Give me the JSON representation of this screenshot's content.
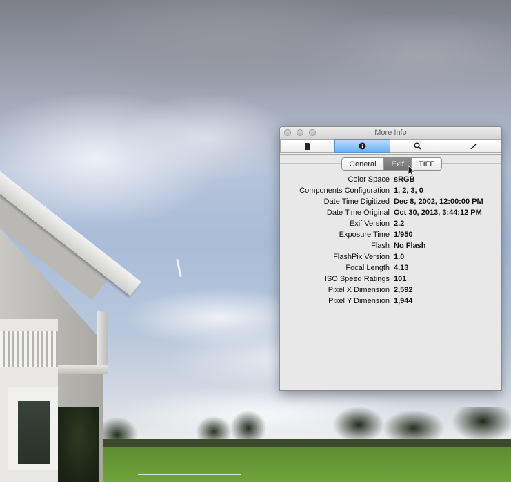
{
  "window": {
    "title": "More Info",
    "toolbar": [
      {
        "name": "general-info",
        "icon": "document-icon"
      },
      {
        "name": "more-info",
        "icon": "info-icon",
        "active": true
      },
      {
        "name": "keywords",
        "icon": "magnifier-icon"
      },
      {
        "name": "annotations",
        "icon": "pen-icon"
      }
    ],
    "tabs": [
      {
        "label": "General",
        "active": false
      },
      {
        "label": "Exif",
        "active": true
      },
      {
        "label": "TIFF",
        "active": false
      }
    ],
    "rows": [
      {
        "key": "Color Space",
        "value": "sRGB"
      },
      {
        "key": "Components Configuration",
        "value": "1, 2, 3, 0"
      },
      {
        "key": "Date Time Digitized",
        "value": "Dec 8, 2002, 12:00:00 PM"
      },
      {
        "key": "Date Time Original",
        "value": "Oct 30, 2013, 3:44:12 PM"
      },
      {
        "key": "Exif Version",
        "value": "2.2"
      },
      {
        "key": "Exposure Time",
        "value": "1/950"
      },
      {
        "key": "Flash",
        "value": "No Flash"
      },
      {
        "key": "FlashPix Version",
        "value": "1.0"
      },
      {
        "key": "Focal Length",
        "value": "4.13"
      },
      {
        "key": "ISO Speed Ratings",
        "value": "101"
      },
      {
        "key": "Pixel X Dimension",
        "value": "2,592"
      },
      {
        "key": "Pixel Y Dimension",
        "value": "1,944"
      }
    ]
  },
  "colors": {
    "active_tool": "#6fb0f5",
    "active_tab": "#808080",
    "panel_bg": "#e8e8e8"
  }
}
